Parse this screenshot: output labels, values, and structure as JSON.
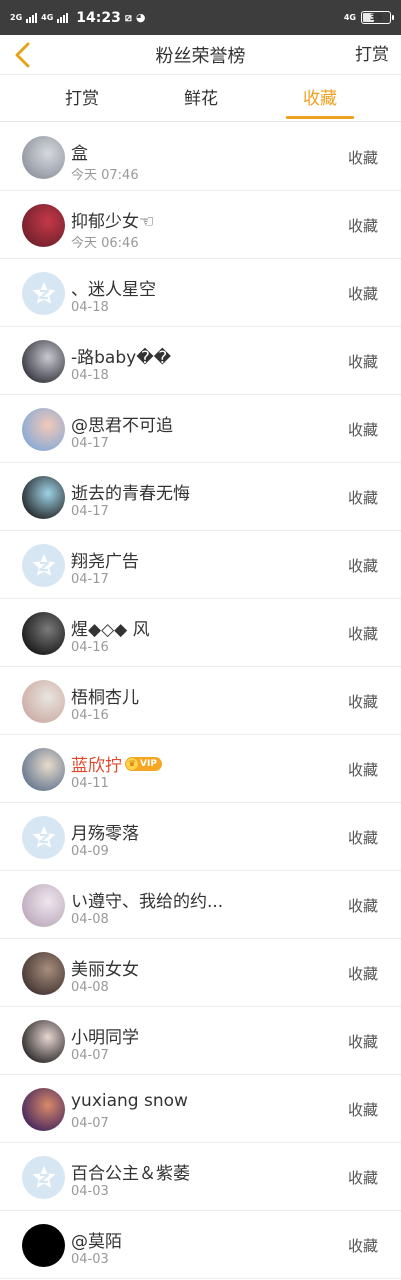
{
  "statusbar": {
    "net1": "2G",
    "net2": "4G",
    "time": "14:23",
    "right_net": "4G",
    "battery": "39",
    "battery_level": 0.39
  },
  "navbar": {
    "title": "粉丝荣誉榜",
    "right": "打赏"
  },
  "tabs": [
    {
      "label": "打赏",
      "active": false
    },
    {
      "label": "鲜花",
      "active": false
    },
    {
      "label": "收藏",
      "active": true
    }
  ],
  "colors": {
    "accent": "#f0a020",
    "vip_name": "#e0482c",
    "default_avatar_bg": "#d7e6f3"
  },
  "rows": [
    {
      "name": "盒",
      "date": "今天 07:46",
      "action": "收藏",
      "avatar": "photo",
      "tint": [
        "#8a8f9a",
        "#d6d9de"
      ]
    },
    {
      "name": "抑郁少女☜",
      "date": "今天 06:46",
      "action": "收藏",
      "avatar": "photo",
      "tint": [
        "#6a1f2a",
        "#c43848"
      ]
    },
    {
      "name": "、迷人星空",
      "date": "04-18",
      "action": "收藏",
      "avatar": "default"
    },
    {
      "name": "-路baby��",
      "date": "04-18",
      "action": "收藏",
      "avatar": "photo",
      "tint": [
        "#2b2b33",
        "#c9c9d2"
      ]
    },
    {
      "name": "@思君不可追",
      "date": "04-17",
      "action": "收藏",
      "avatar": "photo",
      "tint": [
        "#7fa7d9",
        "#f2c9b8"
      ]
    },
    {
      "name": "逝去的青春无悔",
      "date": "04-17",
      "action": "收藏",
      "avatar": "photo",
      "tint": [
        "#1a1a1a",
        "#9fd3e6"
      ]
    },
    {
      "name": "翔尧广告",
      "date": "04-17",
      "action": "收藏",
      "avatar": "default"
    },
    {
      "name": "煋◆◇◆ 风",
      "date": "04-16",
      "action": "收藏",
      "avatar": "photo",
      "tint": [
        "#111111",
        "#7a7a7a"
      ]
    },
    {
      "name": "梧桐杏儿",
      "date": "04-16",
      "action": "收藏",
      "avatar": "photo",
      "tint": [
        "#c9a9a0",
        "#e9e4df"
      ]
    },
    {
      "name": "蓝欣拧",
      "date": "04-11",
      "action": "收藏",
      "avatar": "photo",
      "tint": [
        "#5a6f8c",
        "#e8dccb"
      ],
      "vip": "VIP"
    },
    {
      "name": "月殇零落",
      "date": "04-09",
      "action": "收藏",
      "avatar": "default"
    },
    {
      "name": "い遵守、我给的约...",
      "date": "04-08",
      "action": "收藏",
      "avatar": "photo",
      "tint": [
        "#b9a6b8",
        "#efe6ee"
      ]
    },
    {
      "name": "美丽女女",
      "date": "04-08",
      "action": "收藏",
      "avatar": "photo",
      "tint": [
        "#3b2e2c",
        "#a88e7e"
      ]
    },
    {
      "name": "小明同学",
      "date": "04-07",
      "action": "收藏",
      "avatar": "photo",
      "tint": [
        "#1c1c1c",
        "#e8d6d2"
      ]
    },
    {
      "name": "yuxiang snow",
      "date": "04-07",
      "action": "收藏",
      "avatar": "photo",
      "tint": [
        "#3a1f5c",
        "#d98a6a"
      ]
    },
    {
      "name": "百合公主＆紫萎",
      "date": "04-03",
      "action": "收藏",
      "avatar": "default"
    },
    {
      "name": "@莫陌",
      "date": "04-03",
      "action": "收藏",
      "avatar": "photo",
      "tint": [
        "#000000",
        "#000000"
      ]
    }
  ]
}
